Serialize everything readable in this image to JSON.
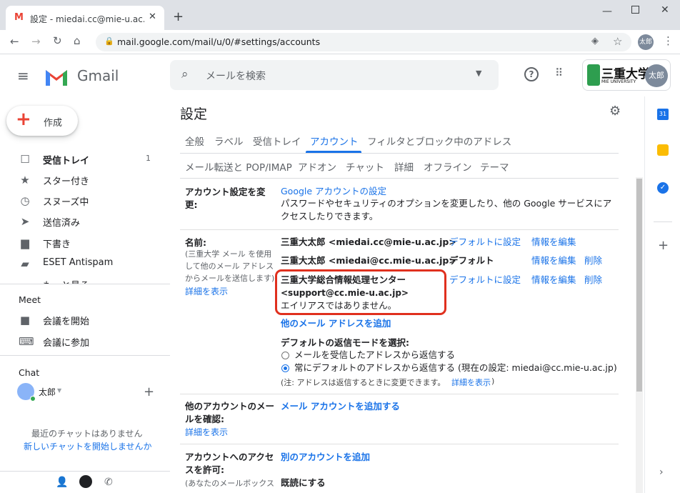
{
  "browser": {
    "tab_title": "設定 - miedai.cc@mie-u.ac.jp - 三",
    "url": "mail.google.com/mail/u/0/#settings/accounts",
    "profile_label": "太郎"
  },
  "header": {
    "app_name": "Gmail",
    "search_placeholder": "メールを検索",
    "org_logo_text": "三重大学",
    "org_logo_sub": "MIE UNIVERSITY",
    "avatar_label": "太郎"
  },
  "sidebar": {
    "compose_label": "作成",
    "items": [
      {
        "label": "受信トレイ",
        "count": "1",
        "icon": "inbox-icon"
      },
      {
        "label": "スター付き",
        "icon": "star-icon"
      },
      {
        "label": "スヌーズ中",
        "icon": "clock-icon"
      },
      {
        "label": "送信済み",
        "icon": "send-icon"
      },
      {
        "label": "下書き",
        "icon": "draft-icon"
      },
      {
        "label": "ESET Antispam",
        "icon": "label-icon"
      },
      {
        "label": "もっと見る",
        "icon": "chevron-down-icon"
      }
    ],
    "meet_heading": "Meet",
    "meet_items": [
      {
        "label": "会議を開始",
        "icon": "video-icon"
      },
      {
        "label": "会議に参加",
        "icon": "keyboard-icon"
      }
    ],
    "chat_heading": "Chat",
    "chat_user": "太郎",
    "no_chats": "最近のチャットはありません",
    "start_chat": "新しいチャットを開始しませんか"
  },
  "settings": {
    "title": "設定",
    "tabs_row1": [
      "全般",
      "ラベル",
      "受信トレイ",
      "アカウント",
      "フィルタとブロック中のアドレス"
    ],
    "tabs_row2": [
      "メール転送と POP/IMAP",
      "アドオン",
      "チャット",
      "詳細",
      "オフライン",
      "テーマ"
    ],
    "active_tab": "アカウント",
    "account_change": {
      "label": "アカウント設定を変更:",
      "link": "Google アカウントの設定",
      "desc": "パスワードやセキュリティのオプションを変更したり、他の Google サービスにアクセスしたりできます。"
    },
    "name": {
      "label": "名前:",
      "note": "(三重大学 メール を使用して他のメール アドレスからメールを送信します)",
      "details_link": "詳細を表示",
      "addresses": [
        {
          "name": "三重大太郎 <miedai.cc@mie-u.ac.jp>",
          "action1": "デフォルトに設定",
          "action2": "情報を編集",
          "action3": ""
        },
        {
          "name": "三重大太郎 <miedai@cc.mie-u.ac.jp>",
          "action1": "デフォルト",
          "action2": "情報を編集",
          "action3": "削除"
        },
        {
          "name": "三重大学総合情報処理センター",
          "name2": "<support@cc.mie-u.ac.jp>",
          "alias_note": "エイリアスではありません。",
          "action1": "デフォルトに設定",
          "action2": "情報を編集",
          "action3": "削除"
        }
      ],
      "add_link": "他のメール アドレスを追加",
      "reply_heading": "デフォルトの返信モードを選択:",
      "reply_option1": "メールを受信したアドレスから返信する",
      "reply_option2": "常にデフォルトのアドレスから返信する (現在の設定: miedai@cc.mie-u.ac.jp)",
      "reply_selected": 2,
      "reply_note": "(注: アドレスは返信するときに変更できます。",
      "reply_note_link": "詳細を表示",
      "reply_note_end": ")"
    },
    "check_mail": {
      "label": "他のアカウントのメールを確認:",
      "link": "メール アカウントを追加する",
      "details_link": "詳細を表示"
    },
    "grant_access": {
      "label": "アカウントへのアクセスを許可:",
      "link": "別のアカウントを追加",
      "note": "(あなたのメールボックス",
      "mark_read": "既読にする"
    }
  },
  "colors": {
    "accent": "#1a73e8",
    "highlight": "#e0301e",
    "gmail_red": "#ea4335"
  }
}
